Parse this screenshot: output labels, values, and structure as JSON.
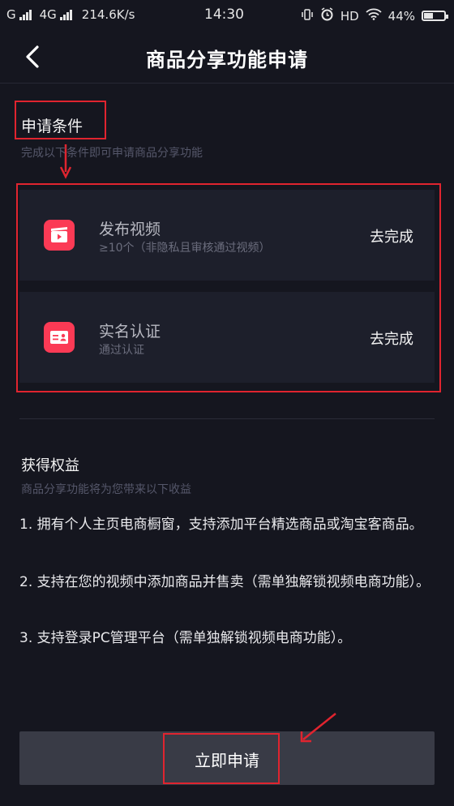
{
  "status_bar": {
    "carrier1": "G",
    "carrier2": "4G",
    "speed": "214.6K/s",
    "time": "14:30",
    "hd": "HD",
    "battery": "44%",
    "battery_level": 0.44
  },
  "header": {
    "title": "商品分享功能申请"
  },
  "conditions": {
    "title": "申请条件",
    "subtitle": "完成以下条件即可申请商品分享功能",
    "items": [
      {
        "icon": "video-clapper-icon",
        "title": "发布视频",
        "subtitle": "≥10个（非隐私且审核通过视频）",
        "action": "去完成"
      },
      {
        "icon": "id-card-icon",
        "title": "实名认证",
        "subtitle": "通过认证",
        "action": "去完成"
      }
    ]
  },
  "benefits": {
    "title": "获得权益",
    "subtitle": "商品分享功能将为您带来以下收益",
    "items": [
      "1. 拥有个人主页电商橱窗，支持添加平台精选商品或淘宝客商品。",
      "2. 支持在您的视频中添加商品并售卖（需单独解锁视频电商功能）。",
      "3. 支持登录PC管理平台（需单独解锁视频电商功能）。"
    ]
  },
  "apply_button": {
    "label": "立即申请"
  },
  "colors": {
    "background": "#15161f",
    "card": "#1d1f2b",
    "accent": "#fb3a55",
    "annotation": "#e0242f",
    "button": "#393b46"
  }
}
